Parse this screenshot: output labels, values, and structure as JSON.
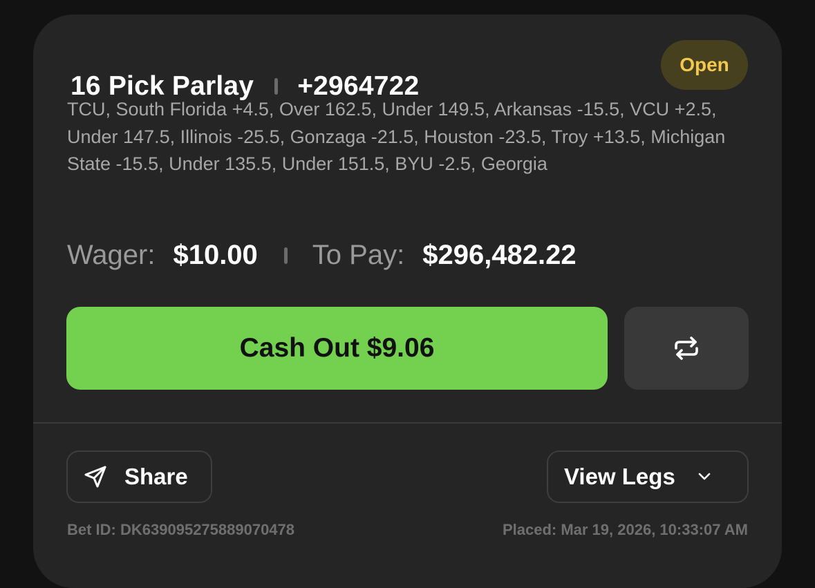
{
  "bet": {
    "title": "16 Pick Parlay",
    "odds": "+2964722",
    "status": "Open",
    "legs_summary": "TCU, South Florida +4.5, Over 162.5, Under 149.5, Arkansas -15.5, VCU +2.5, Under 147.5, Illinois -25.5, Gonzaga -21.5, Houston -23.5, Troy +13.5, Michigan State -15.5, Under 135.5, Under 151.5, BYU -2.5, Georgia"
  },
  "amounts": {
    "wager_label": "Wager:",
    "wager_value": "$10.00",
    "topay_label": "To Pay:",
    "topay_value": "$296,482.22"
  },
  "actions": {
    "cashout_label": "Cash Out $9.06",
    "refresh_icon": "swap-arrows-icon",
    "share_label": "Share",
    "share_icon": "send-icon",
    "viewlegs_label": "View Legs",
    "viewlegs_icon": "chevron-down-icon"
  },
  "footer": {
    "bet_id": "Bet ID: DK639095275889070478",
    "placed": "Placed: Mar 19, 2026, 10:33:07 AM"
  },
  "colors": {
    "background": "#121212",
    "card": "#252525",
    "accent_green": "#74d14f",
    "status_text": "#f2c94c",
    "status_bg": "#46401f"
  }
}
